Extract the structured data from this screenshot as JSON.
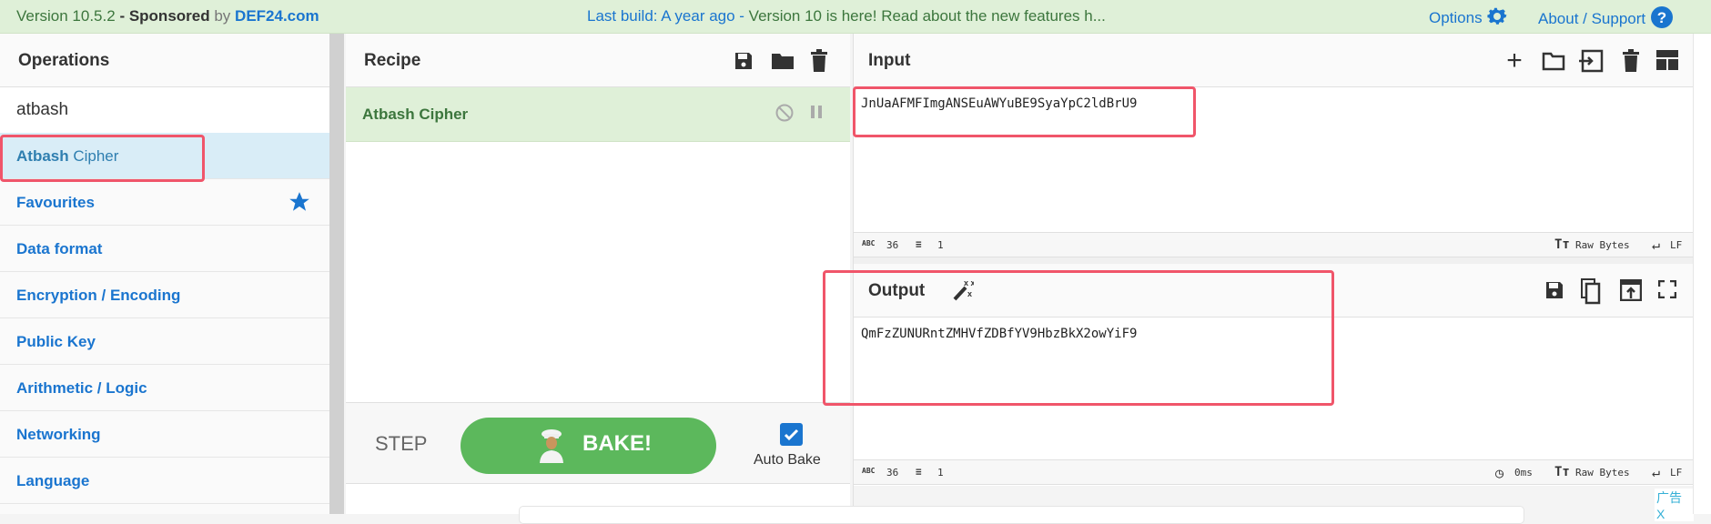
{
  "topbar": {
    "version": "Version 10.5.2",
    "sponsored": "- Sponsored",
    "by": "by",
    "sponsor": "DEF24.com",
    "build_prefix": "Last build: A year ago - ",
    "build_msg": "Version 10 is here! Read about the new features h...",
    "options": "Options",
    "about": "About / Support"
  },
  "operations": {
    "title": "Operations",
    "search_value": "atbash",
    "result": {
      "bold": "Atbash",
      "rest": " Cipher"
    },
    "categories": [
      "Favourites",
      "Data format",
      "Encryption / Encoding",
      "Public Key",
      "Arithmetic / Logic",
      "Networking",
      "Language"
    ]
  },
  "recipe": {
    "title": "Recipe",
    "items": [
      {
        "name": "Atbash Cipher"
      }
    ],
    "step": "STEP",
    "bake": "BAKE!",
    "auto_bake": "Auto Bake",
    "auto_bake_checked": true
  },
  "input": {
    "title": "Input",
    "value": "JnUaAFMFImgANSEuAWYuBE9SyaYpC2ldBrU9",
    "chars": "36",
    "lines": "1",
    "encoding": "Raw Bytes",
    "eol": "LF"
  },
  "output": {
    "title": "Output",
    "value": "QmFzZUNURntZMHVfZDBfYV9HbzBkX2owYiF9",
    "chars": "36",
    "lines": "1",
    "time": "0ms",
    "encoding": "Raw Bytes",
    "eol": "LF"
  },
  "ad": {
    "label": "广告",
    "close": "X"
  },
  "colors": {
    "accent": "#1a75cf",
    "bake": "#5cb85c",
    "highlight": "#f0556a",
    "recipe_bg": "#dff0d8",
    "selected_op": "#d9edf7"
  }
}
